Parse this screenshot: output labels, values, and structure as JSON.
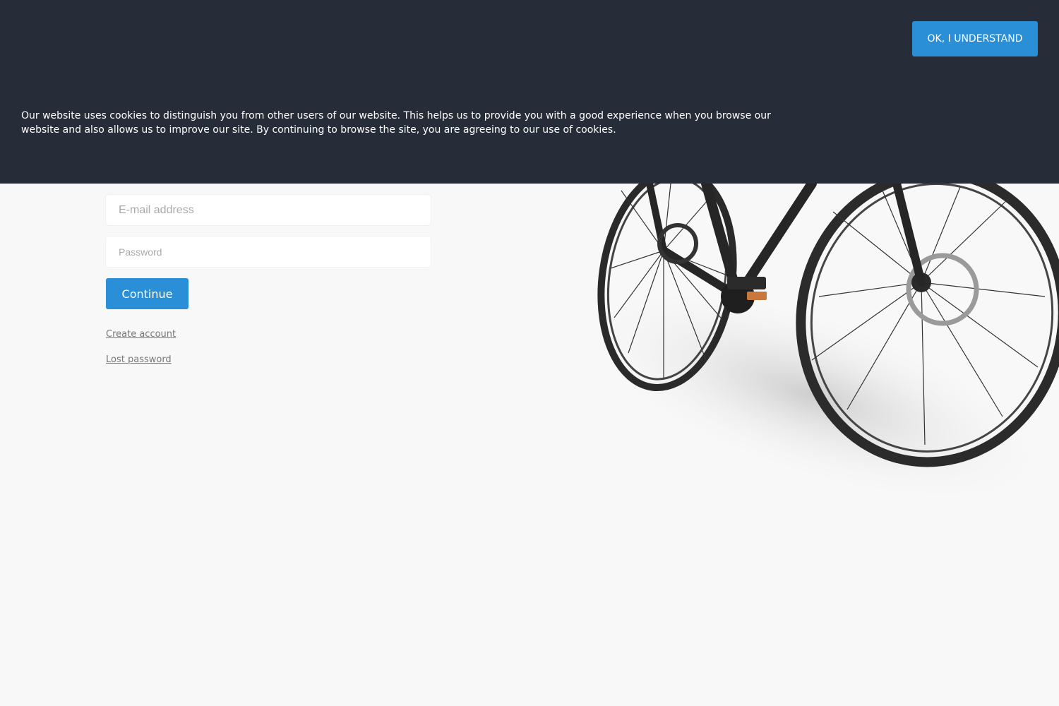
{
  "cookie_banner": {
    "message": "Our website uses cookies to distinguish you from other users of our website. This helps us to provide you with a good experience when you browse our website and also allows us to improve our site. By continuing to browse the site, you are agreeing to our use of cookies.",
    "accept_label": "OK, I UNDERSTAND"
  },
  "login": {
    "email_placeholder": "E-mail address",
    "password_placeholder": "Password",
    "continue_label": "Continue",
    "create_account_label": "Create account",
    "lost_password_label": "Lost password"
  },
  "colors": {
    "banner_background": "#262c38",
    "accent": "#2a8fd7",
    "page_background": "#f8f8f8"
  },
  "hero_image": "bicycle-illustration"
}
